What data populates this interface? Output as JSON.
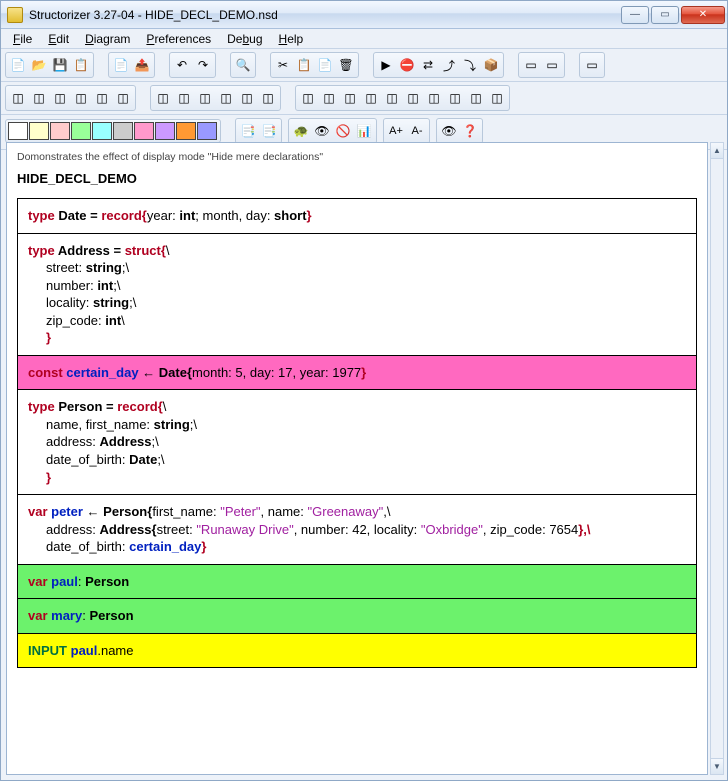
{
  "window": {
    "title": "Structorizer 3.27-04 - HIDE_DECL_DEMO.nsd"
  },
  "menu": {
    "file": "File",
    "file_u": "F",
    "edit": "Edit",
    "edit_u": "E",
    "diagram": "Diagram",
    "diagram_u": "D",
    "preferences": "Preferences",
    "preferences_u": "P",
    "debug": "Debug",
    "debug_u": "b",
    "help": "Help",
    "help_u": "H"
  },
  "toolbar": {
    "row1": {
      "g1": [
        "📄",
        "📂",
        "💾",
        "📋"
      ],
      "g2": [
        "📄",
        "📤"
      ],
      "g3": [
        "↶",
        "↷"
      ],
      "g4": [
        "🔍"
      ],
      "g5": [
        "✂",
        "📋",
        "📄",
        "🗑"
      ],
      "g6": [
        "▶",
        "⛔",
        "⇄",
        "⤴",
        "⤵",
        "📦"
      ],
      "g7": [
        "▭",
        "▭"
      ],
      "g8": [
        "▭"
      ]
    },
    "row2": {
      "g1": [
        "◫",
        "◫",
        "◫",
        "◫",
        "◫",
        "◫"
      ],
      "g2": [
        "◫",
        "◫",
        "◫",
        "◫",
        "◫",
        "◫"
      ],
      "g3": [
        "◫",
        "◫",
        "◫",
        "◫",
        "◫",
        "◫",
        "◫",
        "◫",
        "◫",
        "◫"
      ]
    },
    "row3_extra": [
      "📑",
      "📑",
      "",
      "🐢",
      "👁",
      "🚫",
      "📊",
      "",
      "A+",
      "A-",
      "",
      "👁",
      "❓"
    ]
  },
  "colors": [
    "#ffffff",
    "#ffffcc",
    "#ffcccc",
    "#99ff99",
    "#99ffff",
    "#cccccc",
    "#ff99cc",
    "#cc99ff",
    "#ff9933",
    "#9999ff"
  ],
  "diagram": {
    "comment": "Domonstrates the effect of display mode \"Hide mere declarations\"",
    "name": "HIDE_DECL_DEMO",
    "block1": {
      "l1_a": "type",
      "l1_b": " Date = ",
      "l1_c": "record{",
      "l1_d": "year: ",
      "l1_e": "int",
      "l1_f": "; month, day: ",
      "l1_g": "short",
      "l1_h": "}"
    },
    "block2": {
      "l1_a": "type",
      "l1_b": " Address = ",
      "l1_c": "struct{",
      "l1_d": "\\",
      "l2_a": "street: ",
      "l2_b": "string",
      "l2_c": ";\\",
      "l3_a": "number: ",
      "l3_b": "int",
      "l3_c": ";\\",
      "l4_a": "locality: ",
      "l4_b": "string",
      "l4_c": ";\\",
      "l5_a": "zip_code: ",
      "l5_b": "int",
      "l5_c": "\\",
      "l6": "}"
    },
    "block3": {
      "a": "const ",
      "b": "certain_day",
      "c": " ← ",
      "d": "Date{",
      "e": "month: 5, day: 17, year: 1977",
      "f": "}"
    },
    "block4": {
      "l1_a": "type",
      "l1_b": " Person = ",
      "l1_c": "record{",
      "l1_d": "\\",
      "l2_a": "name, first_name: ",
      "l2_b": "string",
      "l2_c": ";\\",
      "l3_a": "address: ",
      "l3_b": "Address",
      "l3_c": ";\\",
      "l4_a": "date_of_birth: ",
      "l4_b": "Date",
      "l4_c": ";\\",
      "l5": "}"
    },
    "block5": {
      "l1_a": "var ",
      "l1_b": "peter",
      "l1_c": " ← ",
      "l1_d": "Person{",
      "l1_e": "first_name: ",
      "l1_f": "\"Peter\"",
      "l1_g": ", name: ",
      "l1_h": "\"Greenaway\"",
      "l1_i": ",\\",
      "l2_a": "address: ",
      "l2_b": "Address{",
      "l2_c": "street: ",
      "l2_d": "\"Runaway Drive\"",
      "l2_e": ", number: 42, locality: ",
      "l2_f": "\"Oxbridge\"",
      "l2_g": ", zip_code: 7654",
      "l2_h": "},\\",
      "l3_a": "date_of_birth: ",
      "l3_b": "certain_day",
      "l3_c": "}"
    },
    "block6": {
      "a": "var ",
      "b": "paul",
      "c": ": ",
      "d": "Person"
    },
    "block7": {
      "a": "var ",
      "b": "mary",
      "c": ": ",
      "d": "Person"
    },
    "block8": {
      "a": "INPUT ",
      "b": "paul",
      "c": ".name"
    }
  }
}
